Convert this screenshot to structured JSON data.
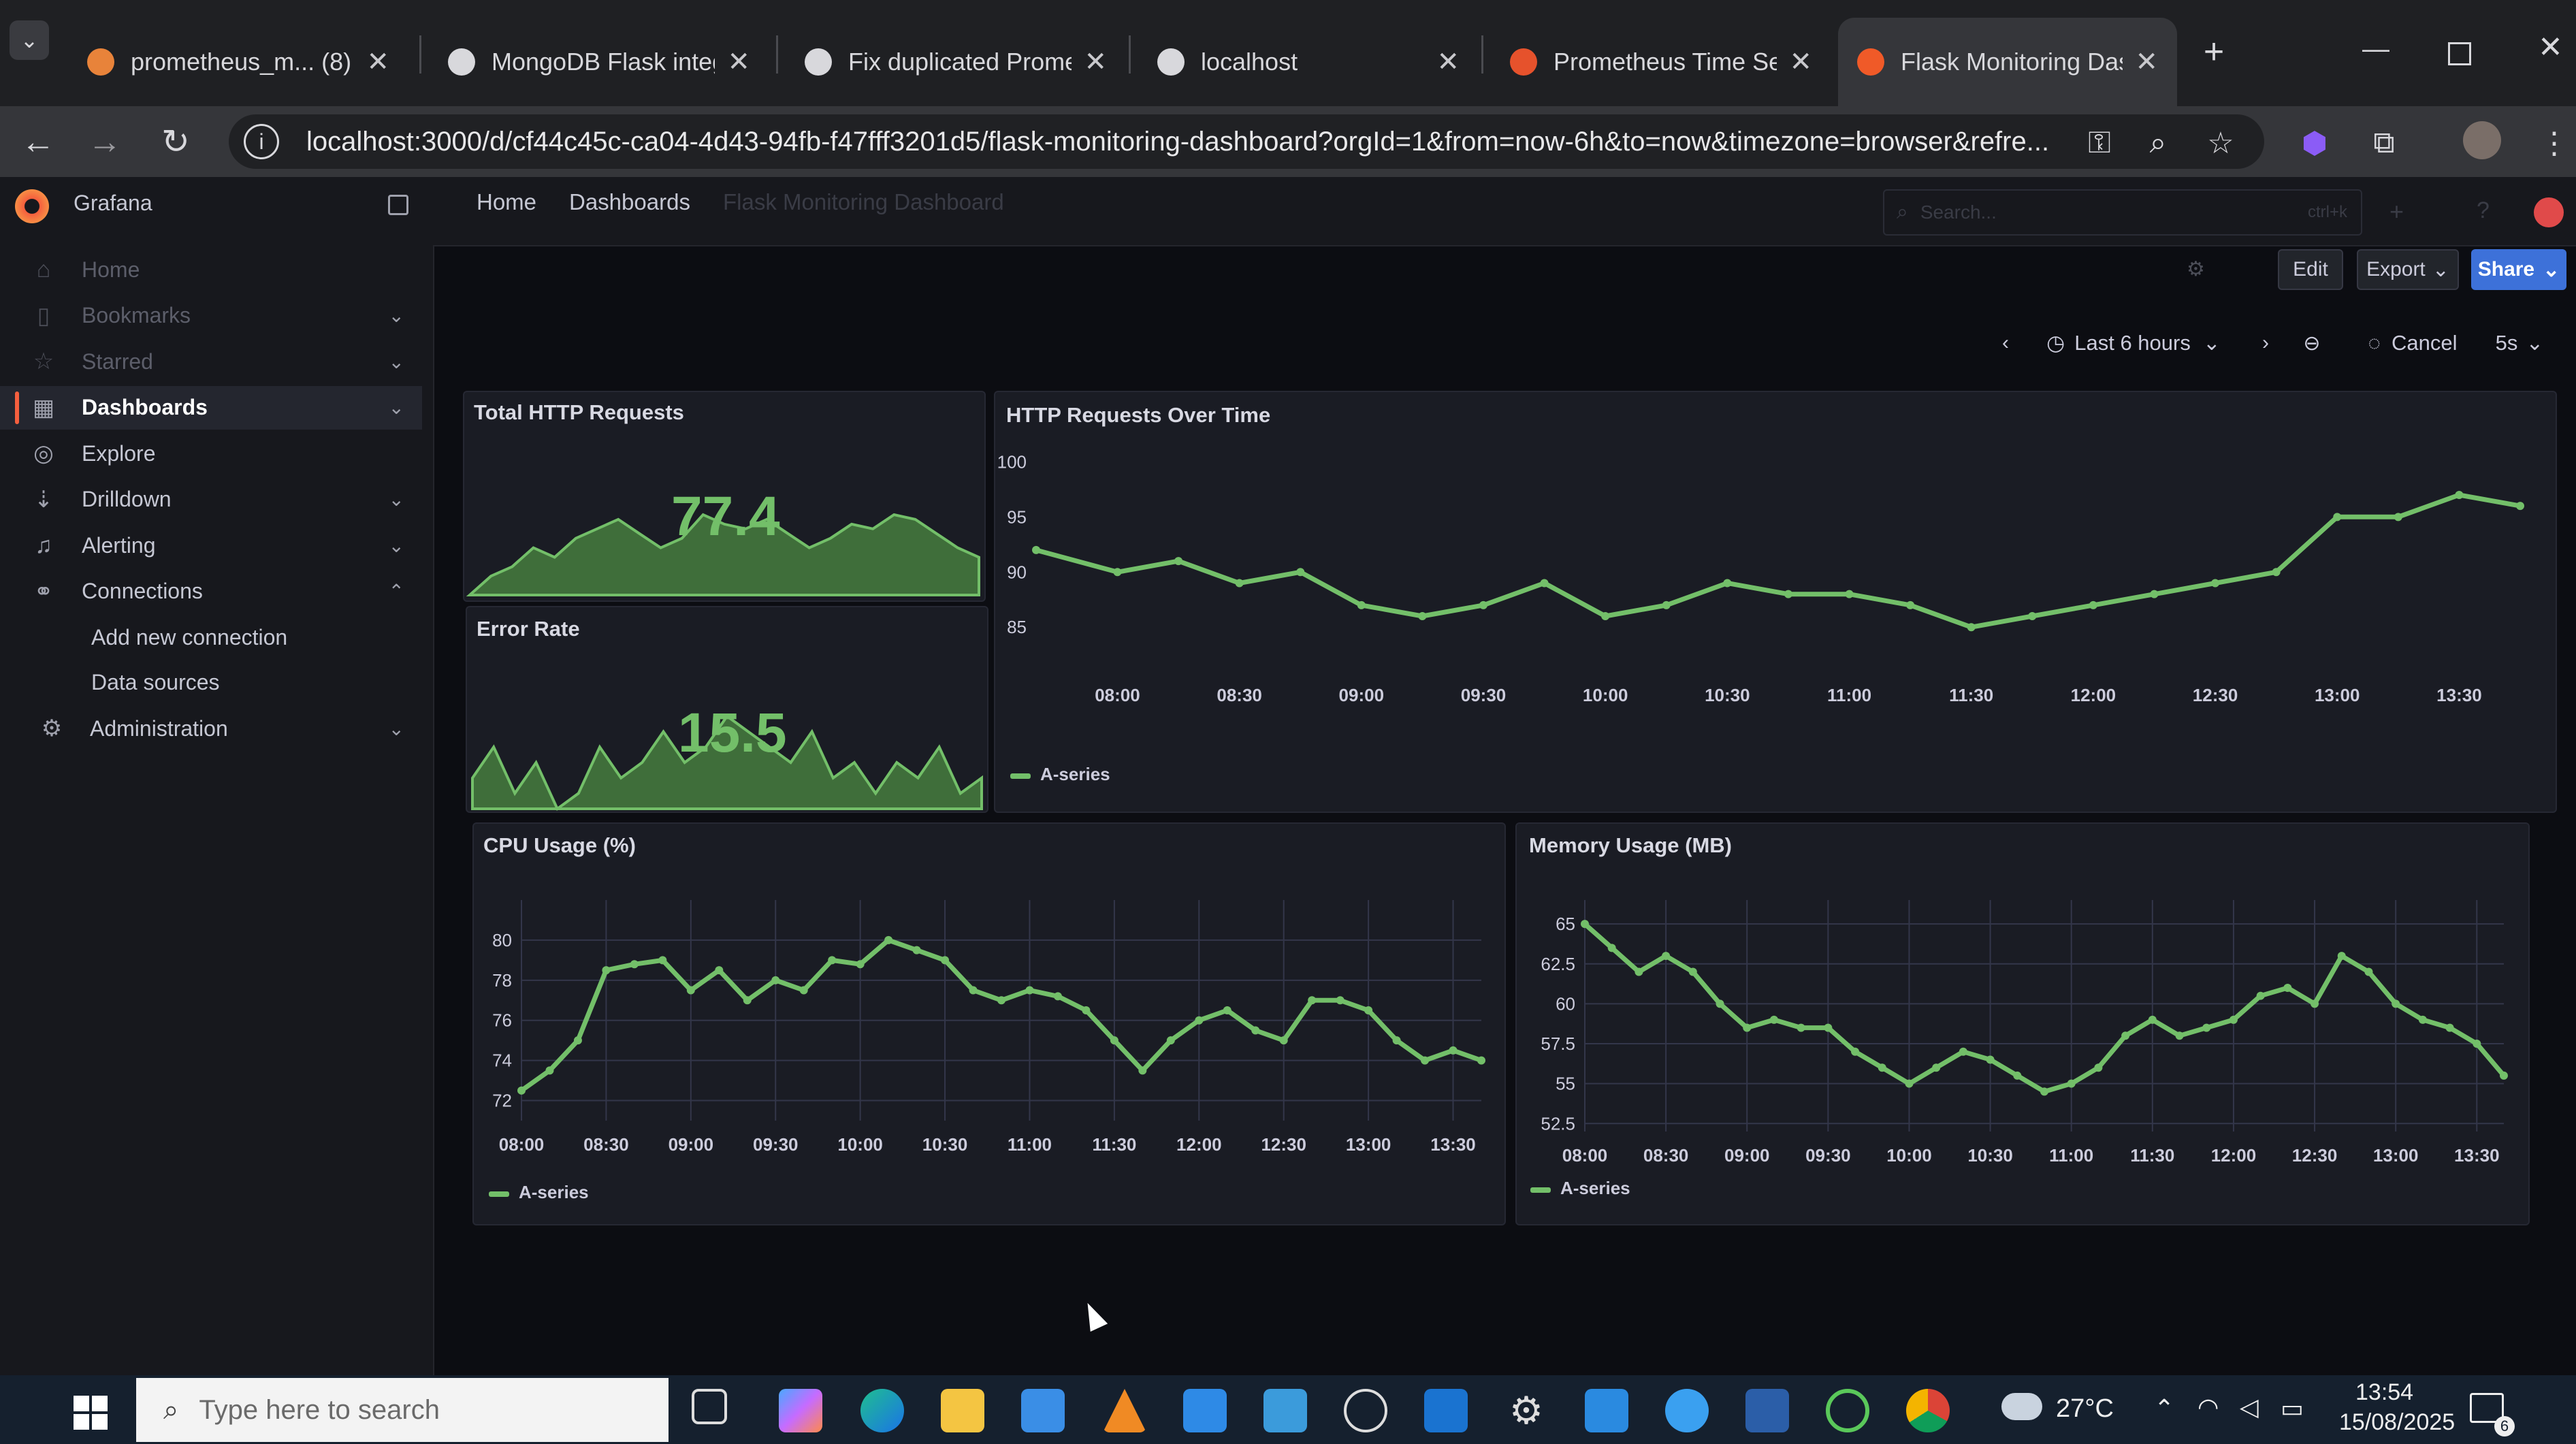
{
  "browser": {
    "tabs": [
      {
        "title": "prometheus_m... (8) -",
        "active": false,
        "favicon_color": "#e8833a"
      },
      {
        "title": "MongoDB Flask integ",
        "active": false,
        "favicon_color": "#d8d8dc"
      },
      {
        "title": "Fix duplicated Prome",
        "active": false,
        "favicon_color": "#d8d8dc"
      },
      {
        "title": "localhost",
        "active": false,
        "favicon_color": "#d8d8dc"
      },
      {
        "title": "Prometheus Time Se",
        "active": false,
        "favicon_color": "#e6522c"
      },
      {
        "title": "Flask Monitoring Das",
        "active": true,
        "favicon_color": "#f05a28"
      }
    ],
    "new_tab_label": "+",
    "url": "localhost:3000/d/cf44c45c-ca04-4d43-94fb-f47fff3201d5/flask-monitoring-dashboard?orgId=1&from=now-6h&to=now&timezone=browser&refre..."
  },
  "grafana": {
    "logo_text": "Grafana",
    "breadcrumbs": [
      "Home",
      "Dashboards",
      "Flask Monitoring Dashboard"
    ],
    "search_placeholder": "Search...",
    "search_shortcut": "ctrl+k",
    "menu": [
      {
        "label": "Home",
        "icon": "home-icon",
        "dim": true,
        "chevron": ""
      },
      {
        "label": "Bookmarks",
        "icon": "bookmark-icon",
        "dim": true,
        "chevron": "⌄"
      },
      {
        "label": "Starred",
        "icon": "star-icon",
        "dim": true,
        "chevron": "⌄"
      },
      {
        "label": "Dashboards",
        "icon": "dashboards-icon",
        "active": true,
        "chevron": "⌄"
      },
      {
        "label": "Explore",
        "icon": "explore-icon",
        "chevron": ""
      },
      {
        "label": "Drilldown",
        "icon": "drilldown-icon",
        "chevron": "⌄"
      },
      {
        "label": "Alerting",
        "icon": "bell-icon",
        "chevron": "⌄"
      },
      {
        "label": "Connections",
        "icon": "connections-icon",
        "chevron": "⌃"
      }
    ],
    "connections_sub": [
      "Add new connection",
      "Data sources"
    ],
    "administration_label": "Administration",
    "actions": {
      "edit": "Edit",
      "export": "Export",
      "share": "Share"
    },
    "timepicker": {
      "range": "Last 6 hours",
      "cancel": "Cancel",
      "refresh": "5s"
    }
  },
  "panels": {
    "total_http": {
      "title": "Total HTTP Requests",
      "value": "77.4"
    },
    "error_rate": {
      "title": "Error Rate",
      "value": "15.5"
    },
    "http_over_time": {
      "title": "HTTP Requests Over Time",
      "legend": "A-series"
    },
    "cpu": {
      "title": "CPU Usage (%)",
      "legend": "A-series"
    },
    "memory": {
      "title": "Memory Usage (MB)",
      "legend": "A-series"
    }
  },
  "chart_data": [
    {
      "id": "http_over_time",
      "type": "line",
      "title": "HTTP Requests Over Time",
      "x": [
        "07:40",
        "08:00",
        "08:15",
        "08:30",
        "08:45",
        "09:00",
        "09:15",
        "09:30",
        "09:45",
        "10:00",
        "10:15",
        "10:30",
        "10:45",
        "11:00",
        "11:15",
        "11:30",
        "11:45",
        "12:00",
        "12:15",
        "12:30",
        "12:45",
        "13:00",
        "13:15",
        "13:30",
        "13:45"
      ],
      "series": [
        {
          "name": "A-series",
          "values": [
            92,
            90,
            91,
            89,
            90,
            87,
            86,
            87,
            89,
            86,
            87,
            89,
            88,
            88,
            87,
            85,
            86,
            87,
            88,
            89,
            90,
            95,
            95,
            97,
            96
          ]
        }
      ],
      "x_ticks": [
        "08:00",
        "08:30",
        "09:00",
        "09:30",
        "10:00",
        "10:30",
        "11:00",
        "11:30",
        "12:00",
        "12:30",
        "13:00",
        "13:30"
      ],
      "y_ticks": [
        "85",
        "90",
        "95",
        "100"
      ],
      "ylim": [
        81,
        102
      ],
      "grid": false,
      "legend": "bottom-left"
    },
    {
      "id": "cpu",
      "type": "line",
      "title": "CPU Usage (%)",
      "x": [
        "08:00",
        "08:10",
        "08:20",
        "08:30",
        "08:40",
        "08:50",
        "09:00",
        "09:10",
        "09:20",
        "09:30",
        "09:40",
        "09:50",
        "10:00",
        "10:10",
        "10:20",
        "10:30",
        "10:40",
        "10:50",
        "11:00",
        "11:10",
        "11:20",
        "11:30",
        "11:40",
        "11:50",
        "12:00",
        "12:10",
        "12:20",
        "12:30",
        "12:40",
        "12:50",
        "13:00",
        "13:10",
        "13:20",
        "13:30",
        "13:40"
      ],
      "series": [
        {
          "name": "A-series",
          "values": [
            72.5,
            73.5,
            75,
            78.5,
            78.8,
            79,
            77.5,
            78.5,
            77,
            78,
            77.5,
            79,
            78.8,
            80,
            79.5,
            79,
            77.5,
            77,
            77.5,
            77.2,
            76.5,
            75,
            73.5,
            75,
            76,
            76.5,
            75.5,
            75,
            77,
            77,
            76.5,
            75,
            74,
            74.5,
            74
          ]
        }
      ],
      "x_ticks": [
        "08:00",
        "08:30",
        "09:00",
        "09:30",
        "10:00",
        "10:30",
        "11:00",
        "11:30",
        "12:00",
        "12:30",
        "13:00",
        "13:30"
      ],
      "y_ticks": [
        "72",
        "74",
        "76",
        "78",
        "80"
      ],
      "ylim": [
        71,
        82
      ],
      "grid": true,
      "legend": "bottom-left"
    },
    {
      "id": "memory",
      "type": "line",
      "title": "Memory Usage (MB)",
      "x": [
        "08:00",
        "08:10",
        "08:20",
        "08:30",
        "08:40",
        "08:50",
        "09:00",
        "09:10",
        "09:20",
        "09:30",
        "09:40",
        "09:50",
        "10:00",
        "10:10",
        "10:20",
        "10:30",
        "10:40",
        "10:50",
        "11:00",
        "11:10",
        "11:20",
        "11:30",
        "11:40",
        "11:50",
        "12:00",
        "12:10",
        "12:20",
        "12:30",
        "12:40",
        "12:50",
        "13:00",
        "13:10",
        "13:20",
        "13:30",
        "13:40"
      ],
      "series": [
        {
          "name": "A-series",
          "values": [
            65,
            63.5,
            62,
            63,
            62,
            60,
            58.5,
            59,
            58.5,
            58.5,
            57,
            56,
            55,
            56,
            57,
            56.5,
            55.5,
            54.5,
            55,
            56,
            58,
            59,
            58,
            58.5,
            59,
            60.5,
            61,
            60,
            63,
            62,
            60,
            59,
            58.5,
            57.5,
            55.5
          ]
        }
      ],
      "x_ticks": [
        "08:00",
        "08:30",
        "09:00",
        "09:30",
        "10:00",
        "10:30",
        "11:00",
        "11:30",
        "12:00",
        "12:30",
        "13:00",
        "13:30"
      ],
      "y_ticks": [
        "52.5",
        "55",
        "57.5",
        "60",
        "62.5",
        "65"
      ],
      "ylim": [
        52,
        66.5
      ],
      "grid": true,
      "legend": "bottom-left"
    },
    {
      "id": "total_http_spark",
      "type": "area",
      "values": [
        60,
        64,
        66,
        70,
        68,
        72,
        74,
        76,
        73,
        70,
        72,
        77,
        75,
        74,
        76,
        73,
        70,
        72,
        75,
        74,
        77,
        76,
        73,
        70,
        68
      ]
    },
    {
      "id": "error_rate_spark",
      "type": "area",
      "values": [
        13,
        15,
        12,
        14,
        11,
        12,
        15,
        13,
        14,
        16,
        14,
        15,
        17,
        16,
        15,
        14,
        16,
        13,
        14,
        12,
        14,
        13,
        15,
        12,
        13
      ]
    }
  ],
  "taskbar": {
    "search_placeholder": "Type here to search",
    "weather": "27°C",
    "time": "13:54",
    "date": "15/08/2025",
    "notification_count": "6"
  },
  "colors": {
    "line_green": "#73bf69",
    "grafana_orange": "#f55f3e",
    "share_blue": "#3d71d9"
  }
}
